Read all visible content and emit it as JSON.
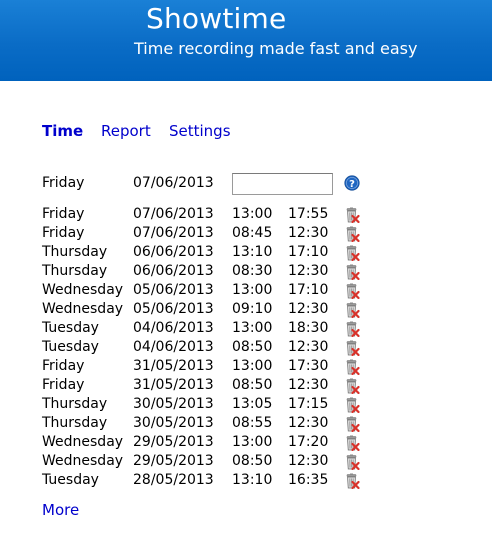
{
  "header": {
    "title": "Showtime",
    "subtitle": "Time recording made fast and easy"
  },
  "nav": [
    {
      "label": "Time",
      "active": true
    },
    {
      "label": "Report",
      "active": false
    },
    {
      "label": "Settings",
      "active": false
    }
  ],
  "new_entry": {
    "day": "Friday",
    "date": "07/06/2013",
    "input_value": ""
  },
  "entries": [
    {
      "day": "Friday",
      "date": "07/06/2013",
      "start": "13:00",
      "end": "17:55"
    },
    {
      "day": "Friday",
      "date": "07/06/2013",
      "start": "08:45",
      "end": "12:30"
    },
    {
      "day": "Thursday",
      "date": "06/06/2013",
      "start": "13:10",
      "end": "17:10"
    },
    {
      "day": "Thursday",
      "date": "06/06/2013",
      "start": "08:30",
      "end": "12:30"
    },
    {
      "day": "Wednesday",
      "date": "05/06/2013",
      "start": "13:00",
      "end": "17:10"
    },
    {
      "day": "Wednesday",
      "date": "05/06/2013",
      "start": "09:10",
      "end": "12:30"
    },
    {
      "day": "Tuesday",
      "date": "04/06/2013",
      "start": "13:00",
      "end": "18:30"
    },
    {
      "day": "Tuesday",
      "date": "04/06/2013",
      "start": "08:50",
      "end": "12:30"
    },
    {
      "day": "Friday",
      "date": "31/05/2013",
      "start": "13:00",
      "end": "17:30"
    },
    {
      "day": "Friday",
      "date": "31/05/2013",
      "start": "08:50",
      "end": "12:30"
    },
    {
      "day": "Thursday",
      "date": "30/05/2013",
      "start": "13:05",
      "end": "17:15"
    },
    {
      "day": "Thursday",
      "date": "30/05/2013",
      "start": "08:55",
      "end": "12:30"
    },
    {
      "day": "Wednesday",
      "date": "29/05/2013",
      "start": "13:00",
      "end": "17:20"
    },
    {
      "day": "Wednesday",
      "date": "29/05/2013",
      "start": "08:50",
      "end": "12:30"
    },
    {
      "day": "Tuesday",
      "date": "28/05/2013",
      "start": "13:10",
      "end": "16:35"
    }
  ],
  "more_label": "More",
  "icons": {
    "help": "help-icon",
    "delete": "trash-delete-icon"
  },
  "colors": {
    "header_top": "#1a80d6",
    "header_bottom": "#0062bd",
    "link": "#0000cc",
    "help_icon": "#1f66c2",
    "delete_x": "#d9322a"
  }
}
